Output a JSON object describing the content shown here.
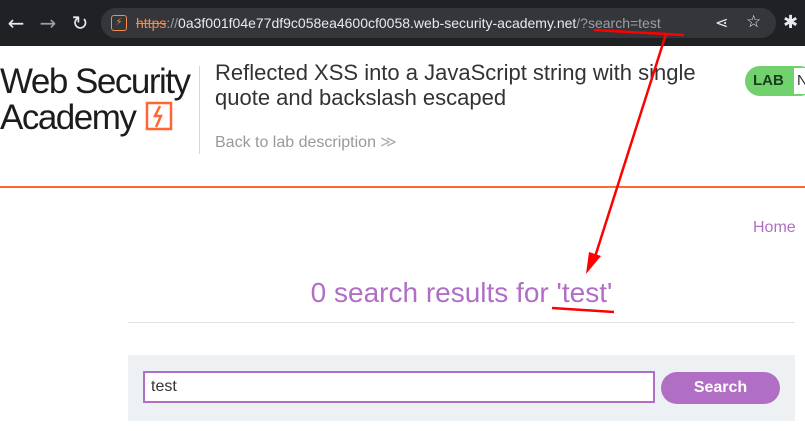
{
  "browser": {
    "url_scheme": "https",
    "url_separator": "://",
    "url_host": "0a3f001f04e77df9c058ea4600cf0058.web-security-academy.net",
    "url_path": "/?search=test",
    "icons": {
      "back": "arrow-left-icon",
      "forward": "arrow-right-icon",
      "reload": "reload-icon",
      "security": "not-secure-warning-icon",
      "share": "share-icon",
      "bookmark": "star-icon",
      "extensions": "puzzle-icon"
    }
  },
  "header": {
    "logo_line1": "Web Security",
    "logo_line2": "Academy",
    "lab_title": "Reflected XSS into a JavaScript string with single quote and backslash escaped",
    "back_link": "Back to lab description",
    "back_chevron": "≫",
    "lab_badge": "LAB",
    "lab_status": "N"
  },
  "nav": {
    "home": "Home"
  },
  "results": {
    "prefix": "0 search results for ",
    "query": "'test'"
  },
  "search": {
    "value": "test",
    "button": "Search"
  },
  "colors": {
    "accent": "#b06fc4",
    "orange": "#ff6633",
    "lab_green": "#70d16d",
    "annotation_red": "#ff0000"
  }
}
